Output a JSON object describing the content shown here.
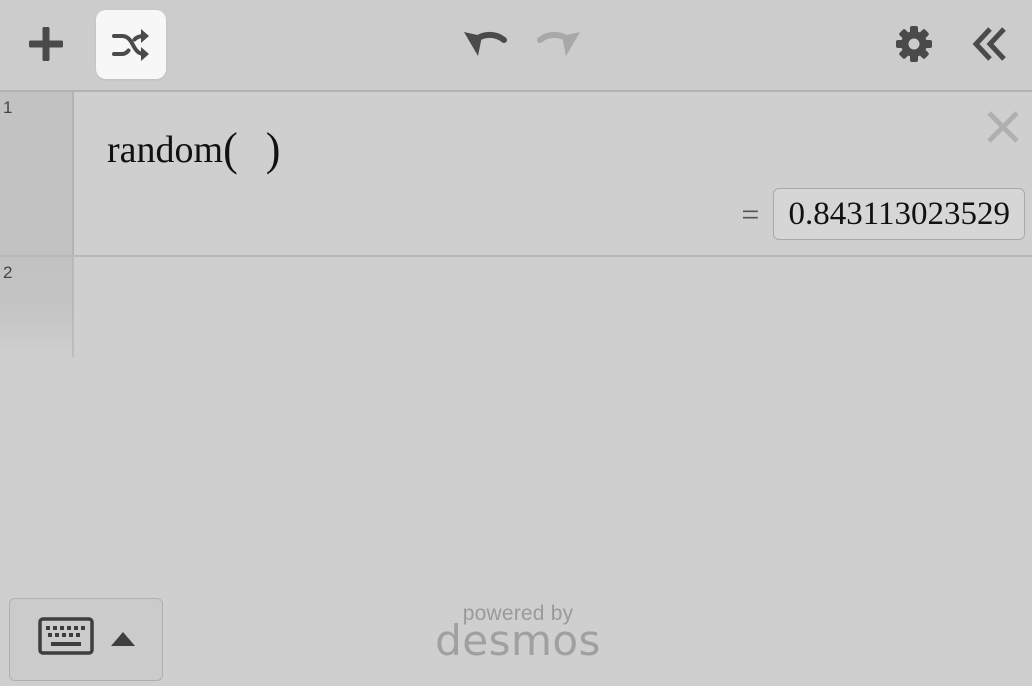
{
  "toolbar": {
    "add_icon": "plus-icon",
    "randomize_icon": "shuffle-icon",
    "undo_icon": "undo-icon",
    "redo_icon": "redo-icon",
    "settings_icon": "gear-icon",
    "collapse_icon": "double-chevron-left-icon"
  },
  "expressions": [
    {
      "index": "1",
      "function": "random",
      "open_paren": "(",
      "close_paren": ")",
      "equals": "=",
      "result": "0.843113023529"
    },
    {
      "index": "2"
    }
  ],
  "keyboard": {
    "icon": "keyboard-icon",
    "caret_icon": "caret-up-icon"
  },
  "branding": {
    "powered_by": "powered by",
    "name": "desmos"
  },
  "colors": {
    "background": "#cfcfcf",
    "active_button": "#f7f7f7",
    "icon_dark": "#4a4a4a",
    "icon_disabled": "#a8a8a8"
  }
}
